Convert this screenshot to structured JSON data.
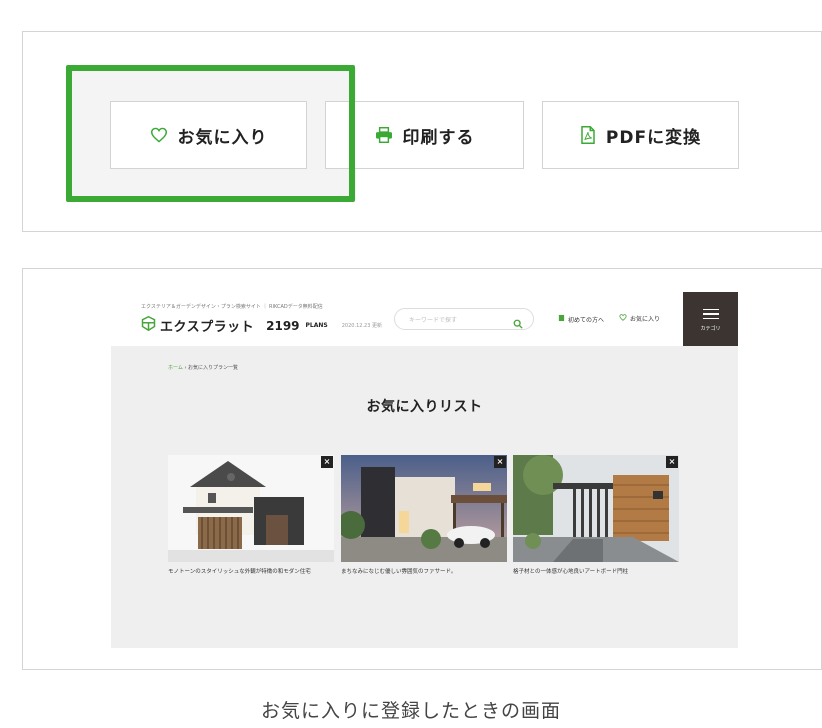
{
  "buttons": {
    "favorite": "お気に入り",
    "print": "印刷する",
    "pdf": "PDFに変換"
  },
  "site": {
    "tagline": "エクステリア＆ガーデンデザイン・プラン検索サイト ｜ RIKCADデータ無料配信",
    "logo": "エクスプラット",
    "plan_count": "2199",
    "plan_unit": "PLANS",
    "updated": "2020.12.23 更新",
    "search_placeholder": "キーワードで探す",
    "nav_first": "初めての方へ",
    "nav_favorite": "お気に入り",
    "menu_label": "カテゴリ",
    "breadcrumb_home": "ホーム",
    "breadcrumb_sep": " › ",
    "breadcrumb_current": "お気に入りプラン一覧",
    "page_title": "お気に入りリスト",
    "cards": [
      {
        "caption": "モノトーンのスタイリッシュな外観が特徴の和モダン住宅",
        "close": "×"
      },
      {
        "caption": "まちなみになじむ優しい雰囲気のファサード。",
        "close": "×"
      },
      {
        "caption": "格子材との一体感が心地良いアートボード門柱",
        "close": "×"
      }
    ]
  },
  "caption": "お気に入りに登録したときの画面",
  "colors": {
    "accent_green": "#3aaa35",
    "dark_menu": "#3b3431"
  }
}
